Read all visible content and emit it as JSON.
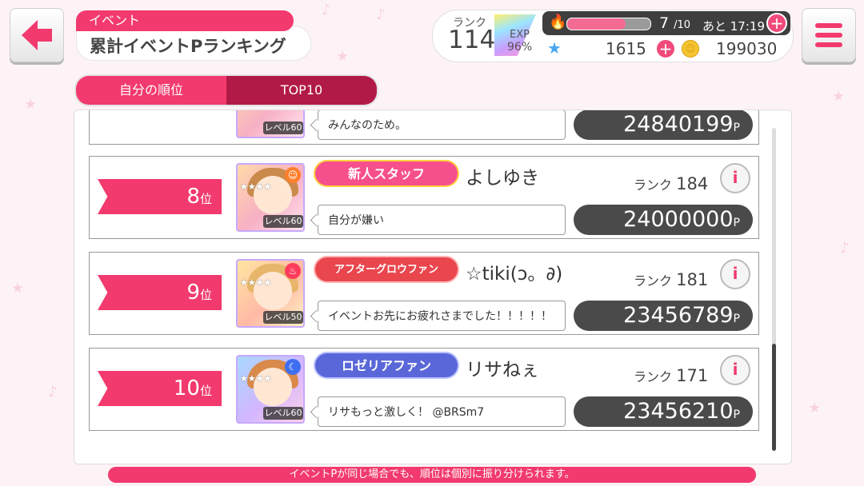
{
  "header": {
    "category": "イベント",
    "title": "累計イベントPランキング"
  },
  "status": {
    "rank_label": "ランク",
    "rank": "114",
    "exp_label": "EXP",
    "exp_percent": "96%",
    "stamina_current": "7",
    "stamina_max": "/10",
    "timer": "あと 17:19",
    "stamina_fraction": 0.7,
    "stars": "1615",
    "coins": "199030"
  },
  "tabs": [
    {
      "label": "自分の順位",
      "active": false
    },
    {
      "label": "TOP10",
      "active": true
    }
  ],
  "partial_row": {
    "level": "レベル60",
    "comment": "みんなのため。",
    "points": "24840199",
    "unit": "P"
  },
  "rows": [
    {
      "rank": "8",
      "rank_suffix": "位",
      "level": "レベル60",
      "attribute_icon": "happy-icon",
      "attribute_color": "#ff7f2a",
      "title_badge": "新人スタッフ",
      "title_color": "#f74f8c",
      "username": "よしゆき",
      "rank_label": "ランク",
      "user_rank": "184",
      "comment": "自分が嫌い",
      "points": "24000000",
      "unit": "P"
    },
    {
      "rank": "9",
      "rank_suffix": "位",
      "level": "レベル50",
      "attribute_icon": "powerful-icon",
      "attribute_color": "#ff3b5c",
      "title_badge": "アフターグロウファン",
      "title_color": "#e9464e",
      "username": "☆tiki(ↄ。∂)",
      "rank_label": "ランク",
      "user_rank": "181",
      "comment": "イベントお先にお疲れさまでした！！！！！",
      "points": "23456789",
      "unit": "P"
    },
    {
      "rank": "10",
      "rank_suffix": "位",
      "level": "レベル60",
      "attribute_icon": "cool-icon",
      "attribute_color": "#3f6ff0",
      "title_badge": "ロゼリアファン",
      "title_color": "#5a67d8",
      "username": "リサねぇ",
      "rank_label": "ランク",
      "user_rank": "171",
      "comment": "リサもっと激しく！ @BRSm7",
      "points": "23456210",
      "unit": "P"
    }
  ],
  "footer": "イベントPが同じ場合でも、順位は個別に振り分けられます。"
}
